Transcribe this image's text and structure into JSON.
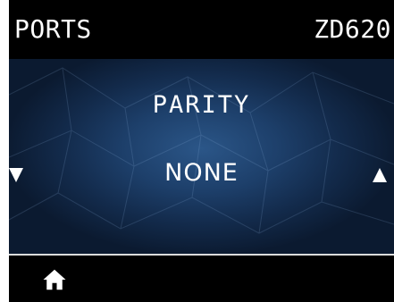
{
  "header": {
    "menu": "PORTS",
    "model": "ZD620"
  },
  "setting": {
    "name": "PARITY",
    "value": "NONE"
  },
  "controls": {
    "prev_icon": "triangle-down-icon",
    "next_icon": "triangle-up-icon",
    "home_icon": "home-icon"
  },
  "colors": {
    "background": "#000000",
    "panel_center": "#2b5688",
    "panel_edge": "#0b1a30",
    "text": "#ffffff"
  }
}
